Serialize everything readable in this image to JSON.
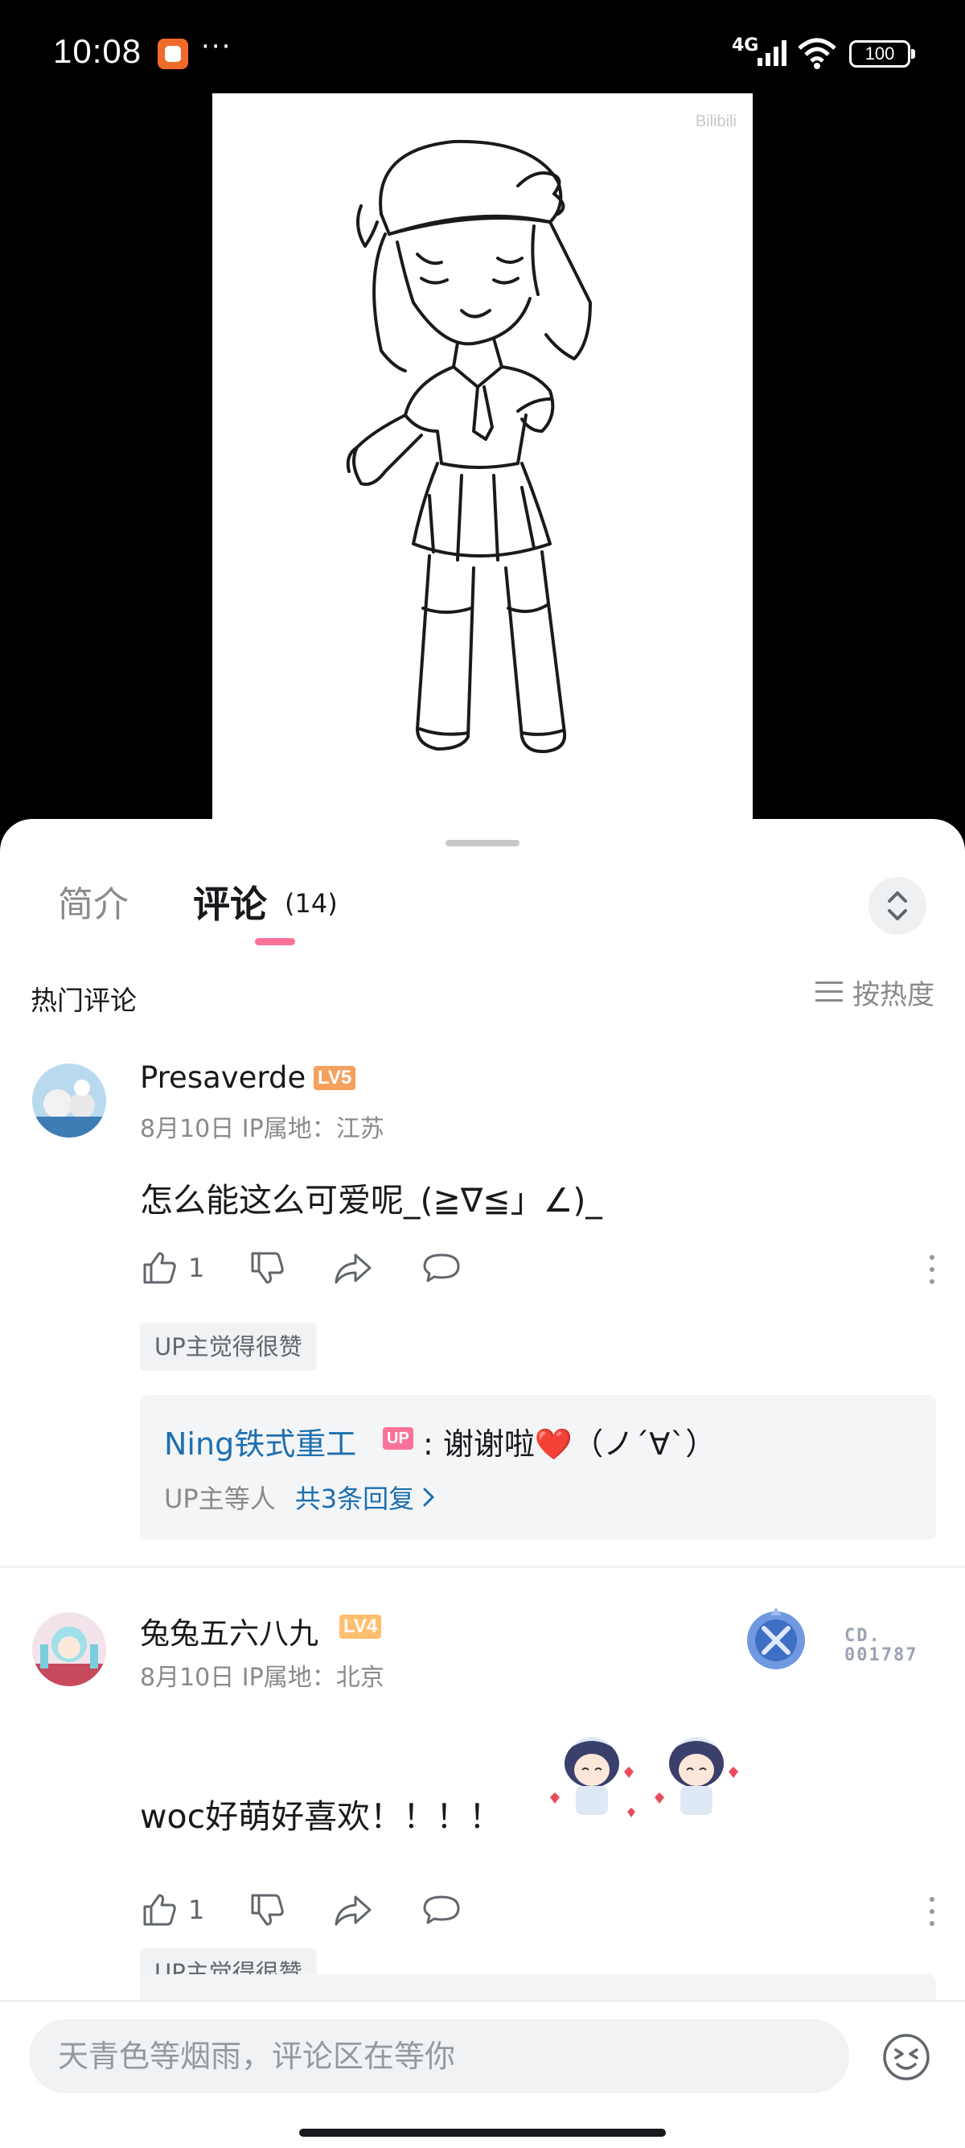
{
  "status_bar": {
    "time": "10:08",
    "dots": "···",
    "network": "4G",
    "battery": "100"
  },
  "video": {
    "watermark": "Bilibili"
  },
  "tabs": {
    "intro": "简介",
    "comments": "评论",
    "count": "(14)"
  },
  "hot": {
    "title": "热门评论",
    "sort": "按热度"
  },
  "comments": [
    {
      "user": "Presaverde",
      "level": "LV5",
      "level_color": "#f5a05c",
      "meta": "8月10日 IP属地：江苏",
      "text": "怎么能这么可爱呢_(≧∇≦」∠)_",
      "likes": "1",
      "tag": "UP主觉得很赞",
      "reply": {
        "name": "Ning铁式重工",
        "badge": "UP",
        "text": ": 谢谢啦❤️（ノ´∀`）",
        "footer": "UP主等人",
        "more": "共3条回复"
      }
    },
    {
      "user": "兔兔五六八九",
      "level": "LV4",
      "level_color": "#ffbf70",
      "meta": "8月10日 IP属地：北京",
      "text": "woc好萌好喜欢！！！！",
      "likes": "1",
      "tag": "UP主觉得很赞",
      "fan_code_line1": "CD.",
      "fan_code_line2": "001787"
    }
  ],
  "input": {
    "placeholder": "天青色等烟雨，评论区在等你"
  },
  "colors": {
    "accent": "#fb7299",
    "link": "#1c6fb0"
  }
}
